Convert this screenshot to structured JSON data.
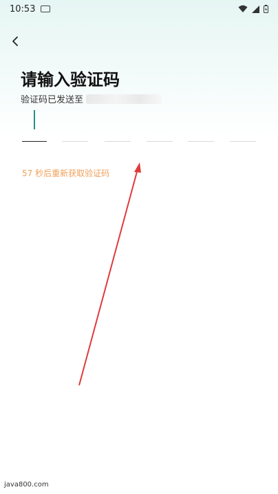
{
  "status_bar": {
    "time": "10:53",
    "icons": [
      "keyboard-icon",
      "wifi-icon",
      "signal-icon",
      "battery-icon"
    ]
  },
  "header": {
    "back_icon": "chevron-left-icon"
  },
  "page": {
    "title": "请输入验证码",
    "subtitle": "验证码已发送至"
  },
  "code_input": {
    "length": 6,
    "active_index": 0
  },
  "resend": {
    "text": "57 秒后重新获取验证码",
    "color": "#f0a05a"
  },
  "watermark": {
    "text": "java800.com"
  },
  "colors": {
    "accent": "#2a8c86",
    "annotation_arrow": "#e03a3a"
  }
}
